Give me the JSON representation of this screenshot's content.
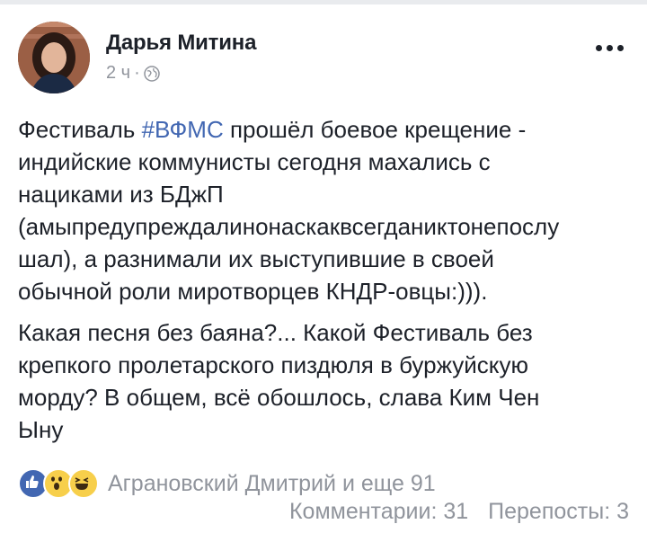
{
  "post": {
    "author": "Дарья Митина",
    "time": "2 ч",
    "separator": "·",
    "privacy_icon": "globe-icon",
    "more_icon": "more-icon",
    "text": {
      "p1_before": "Фестиваль ",
      "hashtag": "#ВФМС",
      "p1_line1_after": " прошёл боевое крещение -",
      "p1_line2": "индийские коммунисты сегодня махались с",
      "p1_line3": "нациками из БДжП",
      "p1_line4": "(амыпредупреждалинонаскаквсегданиктонепослу",
      "p1_line5": "шал), а разнимали их выступившие в своей",
      "p1_line6": "обычной роли миротворцев КНДР-овцы:))).",
      "p2_line1": "Какая песня без баяна?... Какой Фестиваль без",
      "p2_line2": "крепкого пролетарского пиздюля в буржуйскую",
      "p2_line3": "морду? В общем, всё обошлось, слава Ким Чен",
      "p2_line4": "Ыну"
    }
  },
  "reactions": {
    "icons": [
      "like-icon",
      "wow-icon",
      "haha-icon"
    ],
    "summary": "Аграновский Дмитрий и еще 91"
  },
  "counts": {
    "comments": "Комментарии: 31",
    "shares": "Перепосты: 3"
  },
  "colors": {
    "link": "#4267b2",
    "muted": "#90949c",
    "text": "#1d2129"
  }
}
